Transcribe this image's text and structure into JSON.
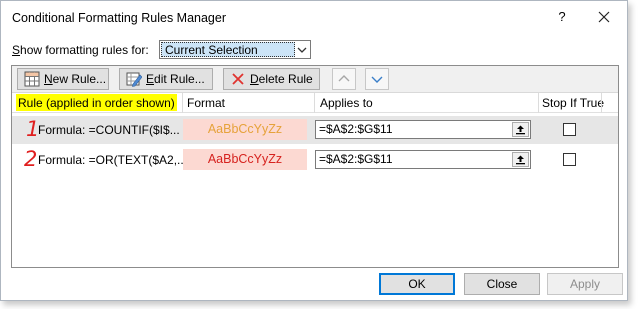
{
  "window": {
    "title": "Conditional Formatting Rules Manager",
    "help_label": "?"
  },
  "filter": {
    "label_accesskey": "S",
    "label_rest": "how formatting rules for:",
    "selected": "Current Selection"
  },
  "toolbar": {
    "new_rule_key": "N",
    "new_rule_rest": "ew Rule...",
    "edit_rule_key": "E",
    "edit_rule_rest": "dit Rule...",
    "delete_rule_key": "D",
    "delete_rule_rest": "elete Rule"
  },
  "columns": {
    "rule": "Rule (applied in order shown)",
    "format": "Format",
    "applies_to": "Applies to",
    "stop_if_true": "Stop If True"
  },
  "rules": [
    {
      "annotation": "1",
      "formula": "Formula: =COUNTIF($I$...",
      "preview": "AaBbCcYyZz",
      "preview_color": "#e6a23a",
      "applies_to": "=$A$2:$G$11",
      "stop_if_true": false
    },
    {
      "annotation": "2",
      "formula": "Formula: =OR(TEXT($A2,...",
      "preview": "AaBbCcYyZz",
      "preview_color": "#d6221e",
      "applies_to": "=$A$2:$G$11",
      "stop_if_true": false
    }
  ],
  "buttons": {
    "ok": "OK",
    "close": "Close",
    "apply": "Apply"
  },
  "colors": {
    "highlight": "#ffff00",
    "selection": "#cce4f7",
    "annotation": "#e01f1f",
    "preview_background": "#fcd9d2"
  }
}
